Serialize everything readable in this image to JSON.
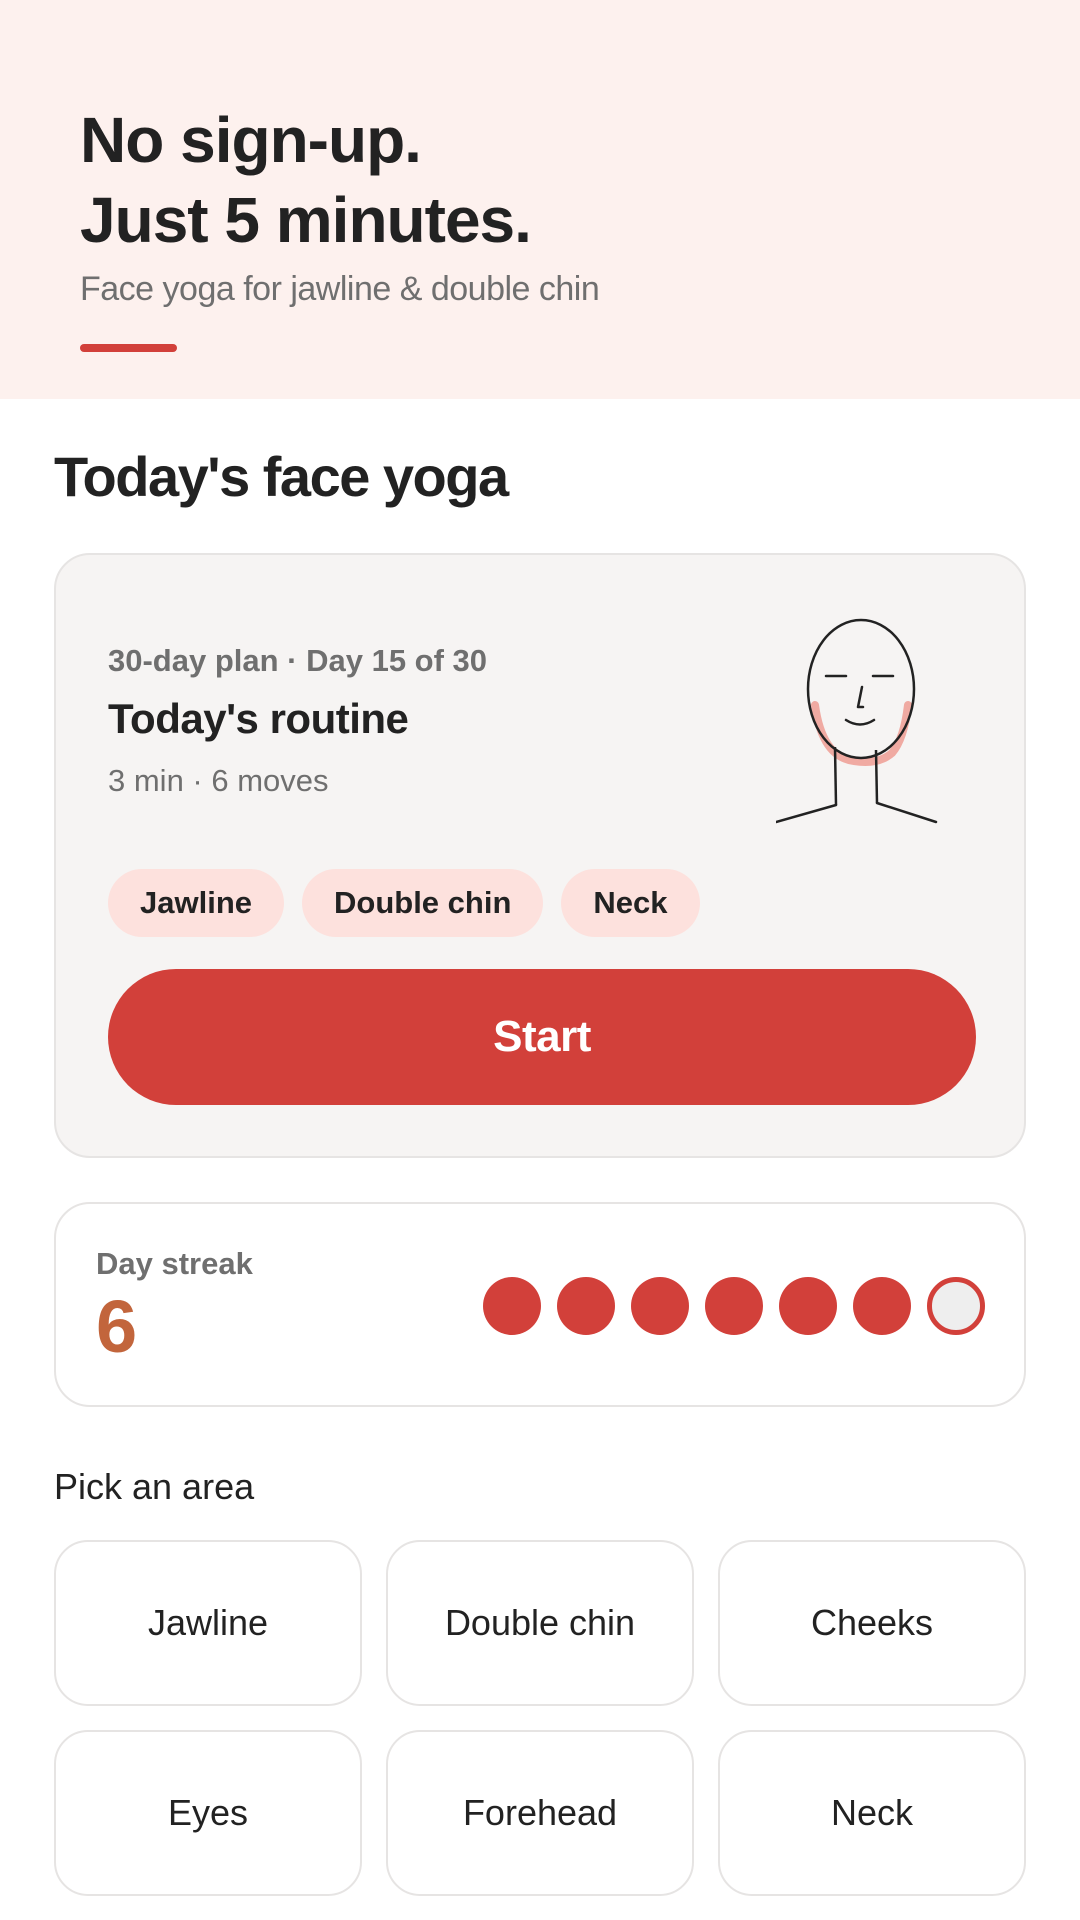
{
  "hero": {
    "title_line1": "No sign-up.",
    "title_line2": "Just 5 minutes.",
    "subtitle": "Face yoga for jawline & double chin",
    "background_color": "#fdf1ee",
    "accent_color": "#d2403a"
  },
  "today": {
    "section_title": "Today's face yoga",
    "plan_label": "30-day plan · Day 15 of 30",
    "routine_title": "Today's routine",
    "routine_meta": "3 min · 6 moves",
    "illustration_icon": "face-jawline-illustration",
    "chips": [
      "Jawline",
      "Double chin",
      "Neck"
    ],
    "start_label": "Start",
    "plan_progress": {
      "current_day": 15,
      "total_days": 30
    }
  },
  "streak": {
    "label": "Day streak",
    "value": "6",
    "dots": [
      true,
      true,
      true,
      true,
      true,
      true,
      false
    ],
    "value_color": "#c2653c",
    "filled_color": "#d2403a"
  },
  "areas": {
    "title": "Pick an area",
    "items": [
      "Jawline",
      "Double chin",
      "Cheeks",
      "Eyes",
      "Forehead",
      "Neck"
    ]
  }
}
